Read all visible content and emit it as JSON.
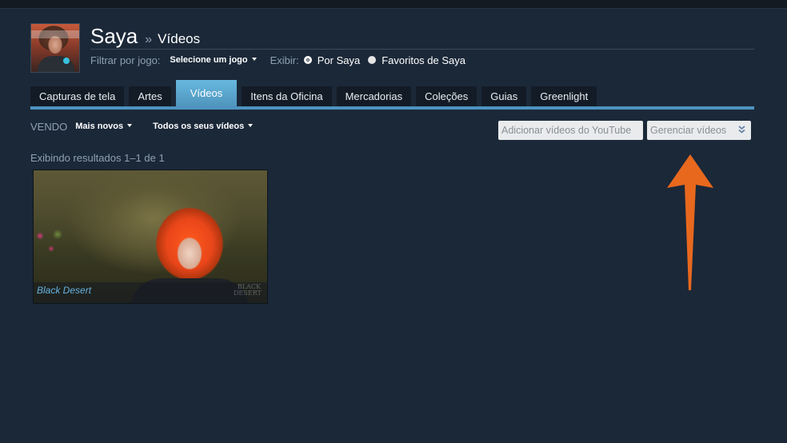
{
  "profile": {
    "name": "Saya",
    "crumb_separator": "»",
    "section": "Vídeos"
  },
  "filter": {
    "label": "Filtrar por jogo:",
    "game_select": "Selecione um jogo",
    "show_label": "Exibir:",
    "options": [
      {
        "label": "Por Saya",
        "selected": true
      },
      {
        "label": "Favoritos de Saya",
        "selected": false
      }
    ]
  },
  "tabs": [
    {
      "label": "Capturas de tela",
      "active": false
    },
    {
      "label": "Artes",
      "active": false
    },
    {
      "label": "Vídeos",
      "active": true
    },
    {
      "label": "Itens da Oficina",
      "active": false
    },
    {
      "label": "Mercadorias",
      "active": false
    },
    {
      "label": "Coleções",
      "active": false
    },
    {
      "label": "Guias",
      "active": false
    },
    {
      "label": "Greenlight",
      "active": false
    }
  ],
  "sort": {
    "label": "VENDO",
    "order": "Mais novos",
    "scope": "Todos os seus vídeos"
  },
  "actions": {
    "add_youtube": "Adicionar vídeos do YouTube",
    "manage": "Gerenciar vídeos",
    "manage_icon": "double-chevron-down-icon"
  },
  "results": {
    "text": "Exibindo resultados 1–1 de 1"
  },
  "videos": [
    {
      "game": "Black Desert",
      "watermark": "BLACK DESERT"
    }
  ],
  "colors": {
    "background": "#1b2838",
    "tab_active": "#58a7cf",
    "tab_line": "#4d93c0",
    "annotation_arrow": "#e8681e"
  }
}
